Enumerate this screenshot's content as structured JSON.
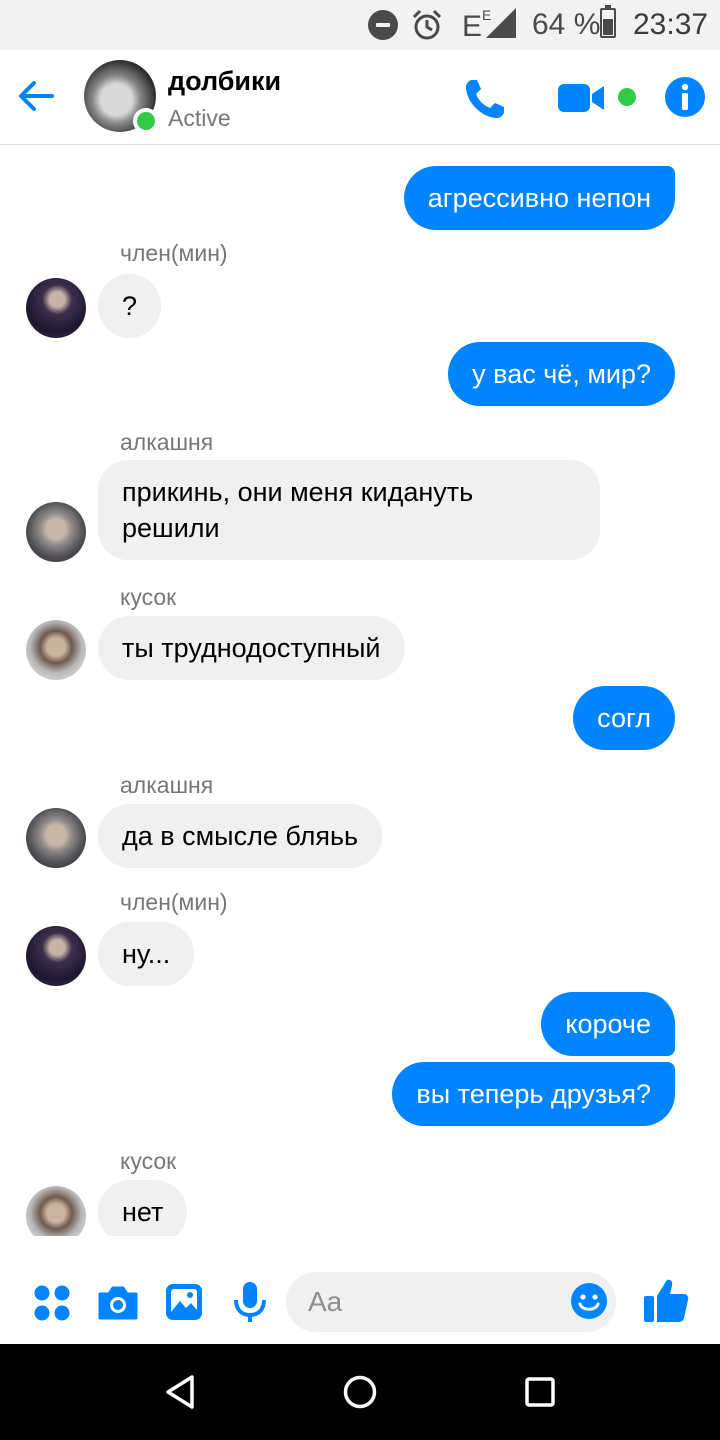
{
  "status_bar": {
    "network_label": "E",
    "battery_percent": "64 %",
    "time": "23:37",
    "icons": [
      "do-not-disturb-icon",
      "alarm-icon",
      "signal-icon",
      "battery-icon"
    ]
  },
  "header": {
    "title": "долбики",
    "status": "Active",
    "icons": [
      "back-arrow-icon",
      "phone-icon",
      "video-camera-icon",
      "info-icon"
    ]
  },
  "messages": [
    {
      "direction": "out",
      "text": "агрессивно непон"
    },
    {
      "direction": "in",
      "sender": "член(мин)",
      "text": "?"
    },
    {
      "direction": "out",
      "text": "у вас чё, мир?"
    },
    {
      "direction": "in",
      "sender": "алкашня",
      "text_lines": [
        "прикинь, они меня кидануть",
        "решили"
      ]
    },
    {
      "direction": "in",
      "sender": "кусок",
      "text": "ты труднодоступный"
    },
    {
      "direction": "out",
      "text": "согл"
    },
    {
      "direction": "in",
      "sender": "алкашня",
      "text": "да в смысле бляьь"
    },
    {
      "direction": "in",
      "sender": "член(мин)",
      "text": "ну..."
    },
    {
      "direction": "out",
      "text": "короче"
    },
    {
      "direction": "out",
      "text": "вы теперь друзья?"
    },
    {
      "direction": "in",
      "sender": "кусок",
      "text": "нет"
    }
  ],
  "composer": {
    "placeholder": "Aa",
    "icons": [
      "apps-grid-icon",
      "camera-icon",
      "gallery-icon",
      "microphone-icon",
      "emoji-icon",
      "thumbs-up-icon"
    ]
  },
  "nav": {
    "icons": [
      "back-triangle-icon",
      "home-circle-icon",
      "recents-square-icon"
    ]
  },
  "colors": {
    "accent": "#0084ff",
    "online": "#31cc46",
    "incoming_bubble": "#f0f0f0",
    "status_bar_bg": "#f2f2f2"
  }
}
